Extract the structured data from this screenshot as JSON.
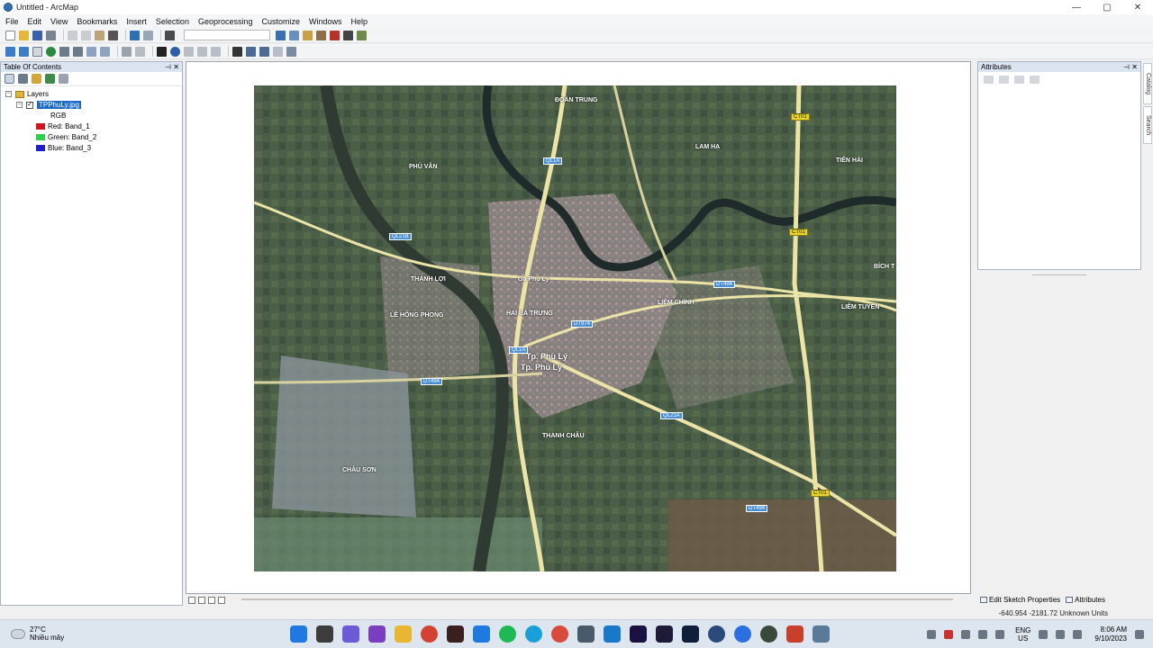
{
  "window": {
    "title": "Untitled - ArcMap",
    "controls": [
      "—",
      "▢",
      "✕"
    ]
  },
  "menu": [
    "File",
    "Edit",
    "View",
    "Bookmarks",
    "Insert",
    "Selection",
    "Geoprocessing",
    "Customize",
    "Windows",
    "Help"
  ],
  "toc": {
    "title": "Table Of Contents",
    "pin": "⊣",
    "close": "✕",
    "root": "Layers",
    "layer": "TPPhuLy.jpg",
    "renderer": "RGB",
    "bands": [
      {
        "label": "Red:   Band_1",
        "color": "#d4141c"
      },
      {
        "label": "Green: Band_2",
        "color": "#2fd14a"
      },
      {
        "label": "Blue:  Band_3",
        "color": "#1a20c8"
      }
    ]
  },
  "attributes": {
    "title": "Attributes",
    "pin": "⊣",
    "close": "✕"
  },
  "side_tabs": [
    "Catalog",
    "Search"
  ],
  "bottom_tabs": [
    "Edit Sketch Properties",
    "Attributes"
  ],
  "status": {
    "coords": "-640.954  -2181.72 Unknown Units"
  },
  "map_labels": {
    "places": [
      "ĐOÀN TRUNG",
      "LAM HẠ",
      "TIÊN HẢI",
      "PHÙ VÂN",
      "THANH LỢI",
      "LÊ HỒNG PHONG",
      "HAI BÀ TRƯNG",
      "LIÊM CHÍNH",
      "LIÊM TUYỀN",
      "THANH CHÂU",
      "CHÂU SƠN",
      "BÍCH T"
    ],
    "city": "Tp. Phủ Lý",
    "city2": "Tp. Phủ Lý",
    "roads_blue": [
      "QL1A",
      "QL21B",
      "DT494",
      "DT974",
      "QL1A",
      "QL21A",
      "DT494",
      "DT494"
    ],
    "roads_yellow": [
      "CT01",
      "CT01",
      "CT01"
    ],
    "poi": "Ga Phủ Lý"
  },
  "taskbar": {
    "temperature": "27°C",
    "condition": "Nhiều mây",
    "lang_top": "ENG",
    "lang_bottom": "US",
    "time": "8:06 AM",
    "date": "9/10/2023"
  },
  "colors": {
    "selection": "#1b6ac9",
    "panel_header": "#dbe4f1",
    "road_blue_shield": "#4a8fd6",
    "road_yellow_shield": "#e7d52b"
  }
}
